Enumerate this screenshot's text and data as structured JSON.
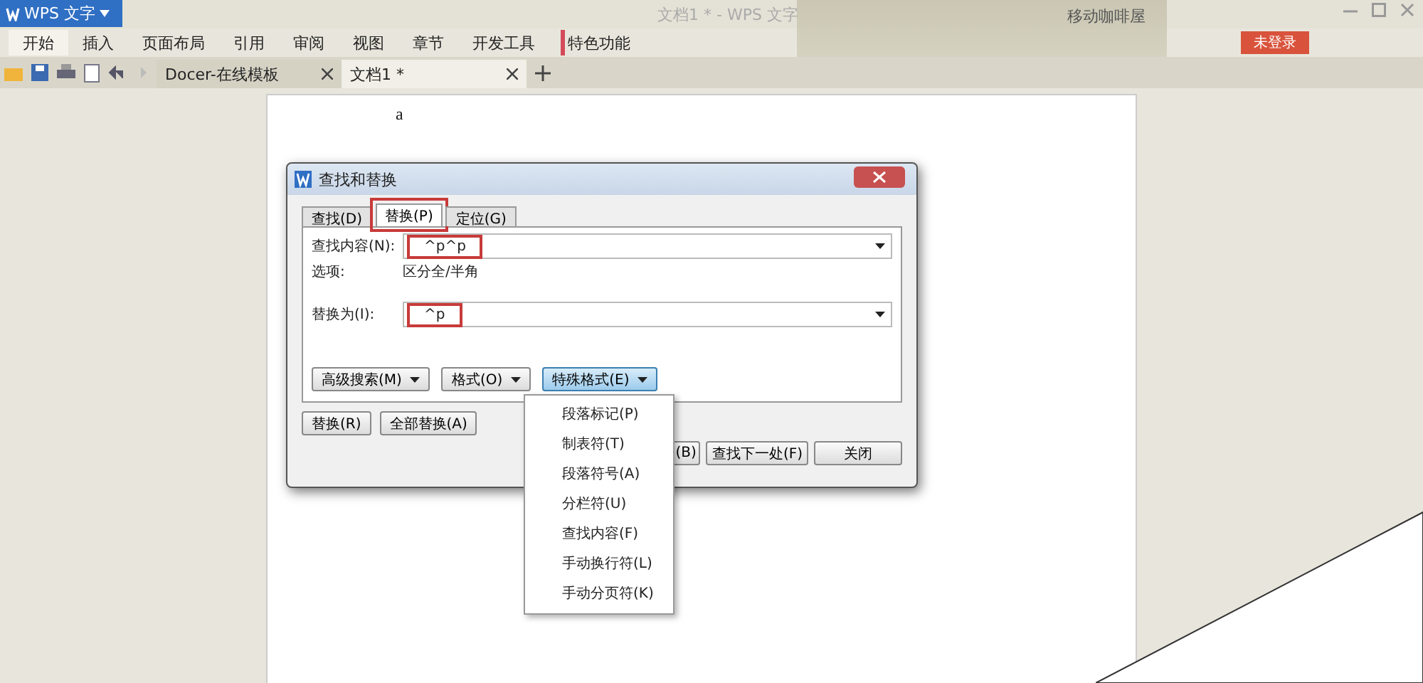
{
  "app_button": {
    "label": "WPS 文字"
  },
  "window": {
    "title": "文档1 * - WPS 文字"
  },
  "banner": {
    "caption": "移动咖啡屋"
  },
  "login_button": {
    "label": "未登录"
  },
  "menu": [
    {
      "label": "开始",
      "selected": true
    },
    {
      "label": "插入",
      "selected": false
    },
    {
      "label": "页面布局",
      "selected": false
    },
    {
      "label": "引用",
      "selected": false
    },
    {
      "label": "审阅",
      "selected": false
    },
    {
      "label": "视图",
      "selected": false
    },
    {
      "label": "章节",
      "selected": false
    },
    {
      "label": "开发工具",
      "selected": false
    },
    {
      "label": "特色功能",
      "selected": false
    }
  ],
  "doc_tabs": [
    {
      "label": "Docer-在线模板",
      "selected": false
    },
    {
      "label": "文档1 *",
      "selected": true
    }
  ],
  "document": {
    "text": "a"
  },
  "dialog": {
    "title": "查找和替换",
    "tabs": [
      {
        "label": "查找(D)",
        "selected": false,
        "highlighted": false
      },
      {
        "label": "替换(P)",
        "selected": true,
        "highlighted": true
      }
    ],
    "tab_extra": {
      "label": "定位(G)",
      "selected": false,
      "highlighted": false
    },
    "find": {
      "label": "查找内容(N):",
      "value": "^p^p",
      "highlighted": true
    },
    "options": {
      "label": "选项:",
      "value": "区分全/半角"
    },
    "replace": {
      "label": "替换为(I):",
      "value": "^p",
      "highlighted": true
    },
    "option_buttons": [
      {
        "label": "高级搜索(M)",
        "selected": false
      },
      {
        "label": "格式(O)",
        "selected": false
      },
      {
        "label": "特殊格式(E)",
        "selected": true
      }
    ],
    "action_buttons": [
      "替换(R)",
      "全部替换(A)"
    ],
    "bottom_buttons": [
      "(B)",
      "查找下一处(F)",
      "关闭"
    ],
    "special_menu": [
      "段落标记(P)",
      "制表符(T)",
      "段落符号(A)",
      "分栏符(U)",
      "查找内容(F)",
      "手动换行符(L)",
      "手动分页符(K)"
    ]
  }
}
